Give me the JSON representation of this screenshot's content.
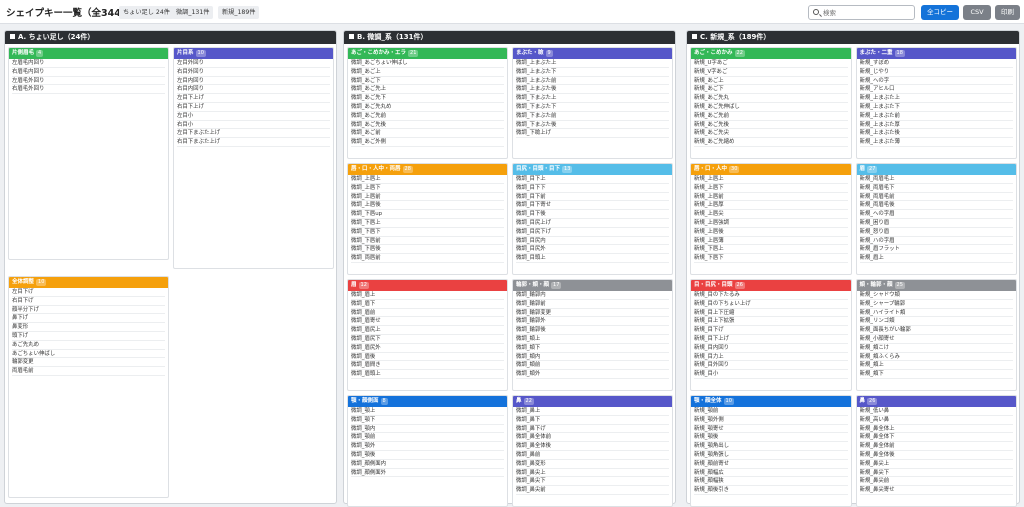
{
  "header": {
    "title": "シェイプキー一覧（全344項目）",
    "chips": [
      "ちょい足し 24件",
      "微調_131件",
      "新規_189件"
    ],
    "search_placeholder": "検索",
    "copy_all": "全コピー",
    "csv": "CSV",
    "print": "印刷"
  },
  "colors": {
    "green": "#33b857",
    "indigo": "#5657c9",
    "orange": "#f5a00c",
    "sky": "#55bde8",
    "red": "#ea4141",
    "gray": "#8e9196",
    "blue": "#1472db",
    "section_header": "#2c2f33"
  },
  "sections": [
    {
      "title": "A. ちょい足し（24件）",
      "groups": [
        {
          "title": "片側眉毛",
          "count": "4",
          "color": "green",
          "items": [
            "左眉毛内回り",
            "右眉毛内回り",
            "左眉毛外回り",
            "右眉毛外回り"
          ]
        },
        {
          "title": "片目系",
          "count": "10",
          "color": "indigo",
          "items": [
            "左目外回り",
            "右目外回り",
            "左目内回り",
            "右目内回り",
            "左目下上げ",
            "右目下上げ",
            "左目小",
            "右目小",
            "左目下まぶた上げ",
            "右目下まぶた上げ"
          ]
        },
        {
          "title": "全体調整",
          "count": "10",
          "color": "orange",
          "items": [
            "左目下げ",
            "右目下げ",
            "顔半分下げ",
            "鼻下げ",
            "鼻変形",
            "頭下げ",
            "あご先丸め",
            "あごちょい伸ばし",
            "輪郭変更",
            "両眉毛前"
          ]
        }
      ]
    },
    {
      "title": "B. 微調_系（131件）",
      "groups": [
        {
          "title": "あご・こめかみ・エラ",
          "count": "21",
          "color": "green",
          "items": [
            "微調_あごちょい伸ばし",
            "微調_あご上",
            "微調_あご下",
            "微調_あご先上",
            "微調_あご先下",
            "微調_あご先丸め",
            "微調_あご先前",
            "微調_あご先後",
            "微調_あご前",
            "微調_あご外側"
          ]
        },
        {
          "title": "まぶた・瞼",
          "count": "9",
          "color": "indigo",
          "items": [
            "微調_上まぶた上",
            "微調_上まぶた下",
            "微調_上まぶた前",
            "微調_上まぶた後",
            "微調_下まぶた上",
            "微調_下まぶた下",
            "微調_下まぶた前",
            "微調_下まぶた後",
            "微調_下瞼上げ"
          ]
        },
        {
          "title": "唇・口・人中・両唇",
          "count": "28",
          "color": "orange",
          "items": [
            "微調_上唇上",
            "微調_上唇下",
            "微調_上唇前",
            "微調_上唇後",
            "微調_下唇up",
            "微調_下唇上",
            "微調_下唇下",
            "微調_下唇前",
            "微調_下唇後",
            "微調_両唇前"
          ]
        },
        {
          "title": "目尻・目頭・目下",
          "count": "13",
          "color": "sky",
          "items": [
            "微調_目下上",
            "微調_目下下",
            "微調_目下前",
            "微調_目下寄せ",
            "微調_目下後",
            "微調_目尻上げ",
            "微調_目尻下げ",
            "微調_目尻内",
            "微調_目尻外",
            "微調_目頭上"
          ]
        },
        {
          "title": "眉",
          "count": "12",
          "color": "red",
          "items": [
            "微調_眉上",
            "微調_眉下",
            "微調_眉前",
            "微調_眉寄せ",
            "微調_眉尻上",
            "微調_眉尻下",
            "微調_眉尻外",
            "微調_眉後",
            "微調_眉間き",
            "微調_眉頭上"
          ]
        },
        {
          "title": "輪郭・頬・顔",
          "count": "17",
          "color": "gray",
          "items": [
            "微調_輪郭内",
            "微調_輪郭前",
            "微調_輪郭変更",
            "微調_輪郭外",
            "微調_輪郭後",
            "微調_頬上",
            "微調_頬下",
            "微調_頬内",
            "微調_頬前",
            "微調_頬外"
          ]
        },
        {
          "title": "顎・顔側面",
          "count": "8",
          "color": "blue",
          "items": [
            "微調_顎上",
            "微調_顎下",
            "微調_顎内",
            "微調_顎前",
            "微調_顎外",
            "微調_顎後",
            "微調_顔側面内",
            "微調_顔側面外"
          ]
        },
        {
          "title": "鼻",
          "count": "22",
          "color": "indigo",
          "items": [
            "微調_鼻上",
            "微調_鼻下",
            "微調_鼻下げ",
            "微調_鼻全体前",
            "微調_鼻全体後",
            "微調_鼻前",
            "微調_鼻変形",
            "微調_鼻尖上",
            "微調_鼻尖下",
            "微調_鼻尖前"
          ]
        }
      ]
    },
    {
      "title": "C. 新規_系（189件）",
      "groups": [
        {
          "title": "あご・こめかみ",
          "count": "22",
          "color": "green",
          "items": [
            "新規_U字あご",
            "新規_V字あご",
            "新規_あご上",
            "新規_あご下",
            "新規_あご先丸",
            "新規_あご先伸ばし",
            "新規_あご先前",
            "新規_あご先後",
            "新規_あご先尖",
            "新規_あご先縮め"
          ]
        },
        {
          "title": "まぶた・二重",
          "count": "18",
          "color": "indigo",
          "items": [
            "新規_すぼめ",
            "新規_じやり",
            "新規_ヘの字",
            "新規_アヒル口",
            "新規_上まぶた上",
            "新規_上まぶた下",
            "新規_上まぶた前",
            "新規_上まぶた厚",
            "新規_上まぶた後",
            "新規_上まぶた薄"
          ]
        },
        {
          "title": "唇・口・人中",
          "count": "30",
          "color": "orange",
          "items": [
            "新規_上唇上",
            "新規_上唇下",
            "新規_上唇前",
            "新規_上唇厚",
            "新規_上唇尖",
            "新規_上唇強調",
            "新規_上唇後",
            "新規_上唇薄",
            "新規_下唇上",
            "新規_下唇下"
          ]
        },
        {
          "title": "眉",
          "count": "27",
          "color": "sky",
          "items": [
            "新規_両眉毛上",
            "新規_両眉毛下",
            "新規_両眉毛前",
            "新規_両眉毛後",
            "新規_への字眉",
            "新規_困り眉",
            "新規_怒り眉",
            "新規_ハの字眉",
            "新規_眉フラット",
            "新規_眉上"
          ]
        },
        {
          "title": "目・目尻・目頭",
          "count": "26",
          "color": "red",
          "items": [
            "新規_目の下たるみ",
            "新規_目の下ちょい上げ",
            "新規_目上下圧縮",
            "新規_目上下拡張",
            "新規_目下げ",
            "新規_目下上げ",
            "新規_目内回り",
            "新規_目力上",
            "新規_目外回り",
            "新規_目小"
          ]
        },
        {
          "title": "頬・輪郭・顔",
          "count": "25",
          "color": "gray",
          "items": [
            "新規_シャドウ頬",
            "新規_シャープ輪郭",
            "新規_ハイライト頬",
            "新規_リンゴ頬",
            "新規_面長ちがい輪郭",
            "新規_小顔寄せ",
            "新規_頬こけ",
            "新規_頬ふくらみ",
            "新規_頬上",
            "新規_頬下"
          ]
        },
        {
          "title": "顎・顔全体",
          "count": "10",
          "color": "blue",
          "items": [
            "新規_顎前",
            "新規_顎外側",
            "新規_顎寄せ",
            "新規_顎後",
            "新規_顎角出し",
            "新規_顎角張し",
            "新規_顔前寄せ",
            "新規_顔幅広",
            "新規_顔幅狭",
            "新規_顔後引き"
          ]
        },
        {
          "title": "鼻",
          "count": "26",
          "color": "indigo",
          "items": [
            "新規_低い鼻",
            "新規_高い鼻",
            "新規_鼻全体上",
            "新規_鼻全体下",
            "新規_鼻全体前",
            "新規_鼻全体後",
            "新規_鼻尖上",
            "新規_鼻尖下",
            "新規_鼻尖前",
            "新規_鼻尖寄せ"
          ]
        }
      ]
    }
  ]
}
